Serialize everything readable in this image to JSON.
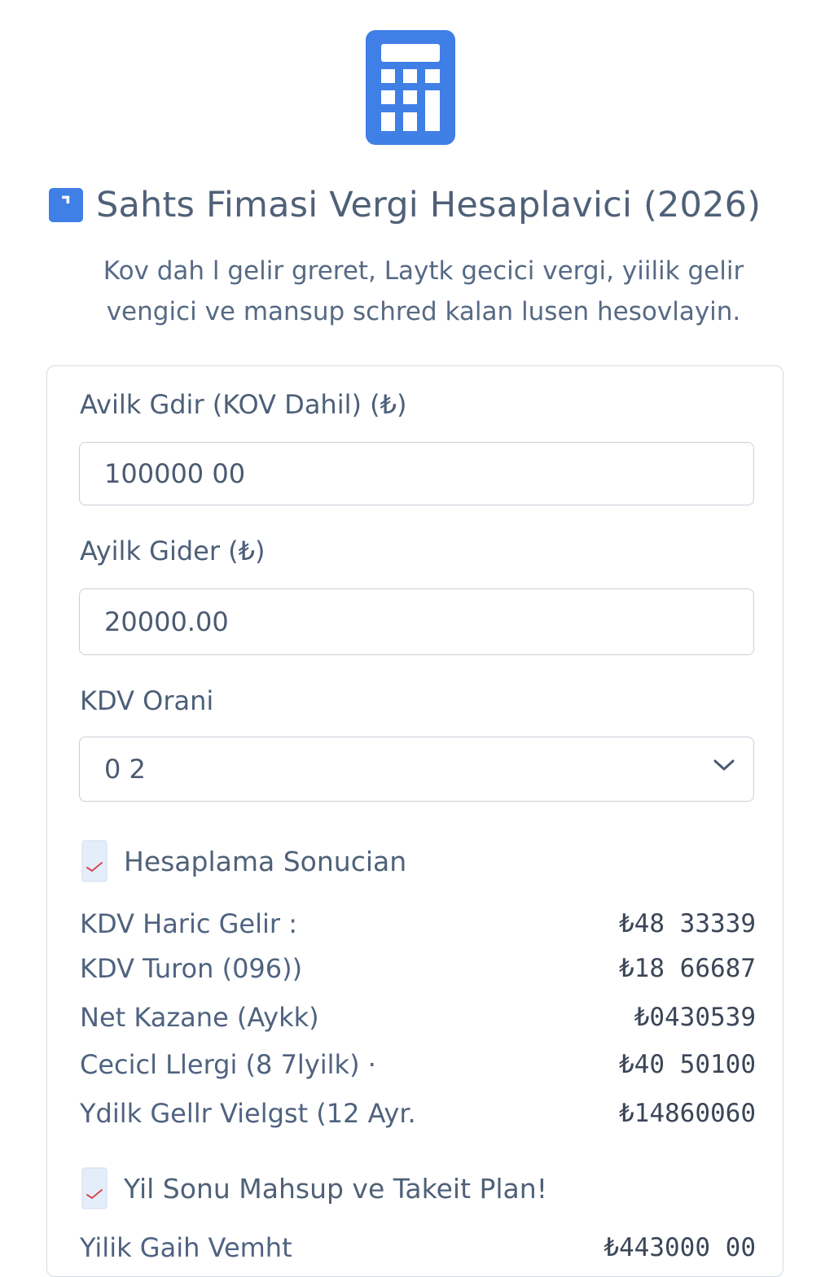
{
  "header": {
    "app_icon": "calculator-icon",
    "badge_icon": "numbered-badge-icon",
    "title": "Sahts Fimasi Vergi Hesaplavici (2026)",
    "subtitle_line1": "Kov dah l gelir greret, Laytk gecici vergi, yiilik gelir",
    "subtitle_line2": "vengici ve mansup schred kalan lusen hesovlayin.",
    "accent_color": "#3f7fe6"
  },
  "form": {
    "income_label": "Avilk Gdir (KOV Dahil) (₺)",
    "income_value": "100000 00",
    "expense_label": "Ayilk Gider (₺)",
    "expense_value": "20000.00",
    "vat_label": "KDV Orani",
    "vat_selected": "0 2"
  },
  "results": {
    "section_title": "Hesaplama Sonucian",
    "section_icon": "checkbox-check-icon",
    "rows": [
      {
        "label": "KDV Haric Gelir :",
        "value": "₺48 33339"
      },
      {
        "label": "KDV Turon (096))",
        "value": "₺18 66687"
      },
      {
        "label": "Net Kazane (Aykk)",
        "value": "₺0430539"
      },
      {
        "label": "Cecicl Llergi (8 7lyilk) ·",
        "value": "₺40 50100"
      },
      {
        "label": "Ydilk Gellr Vielgst (12 Ayr.",
        "value": "₺14860060"
      }
    ]
  },
  "plan": {
    "section_title": "Yil Sonu Mahsup ve Takeit Plan!",
    "section_icon": "checkbox-check-icon",
    "row_label": "Yilik Gaih Vemht",
    "row_value": "₺443000 00"
  }
}
